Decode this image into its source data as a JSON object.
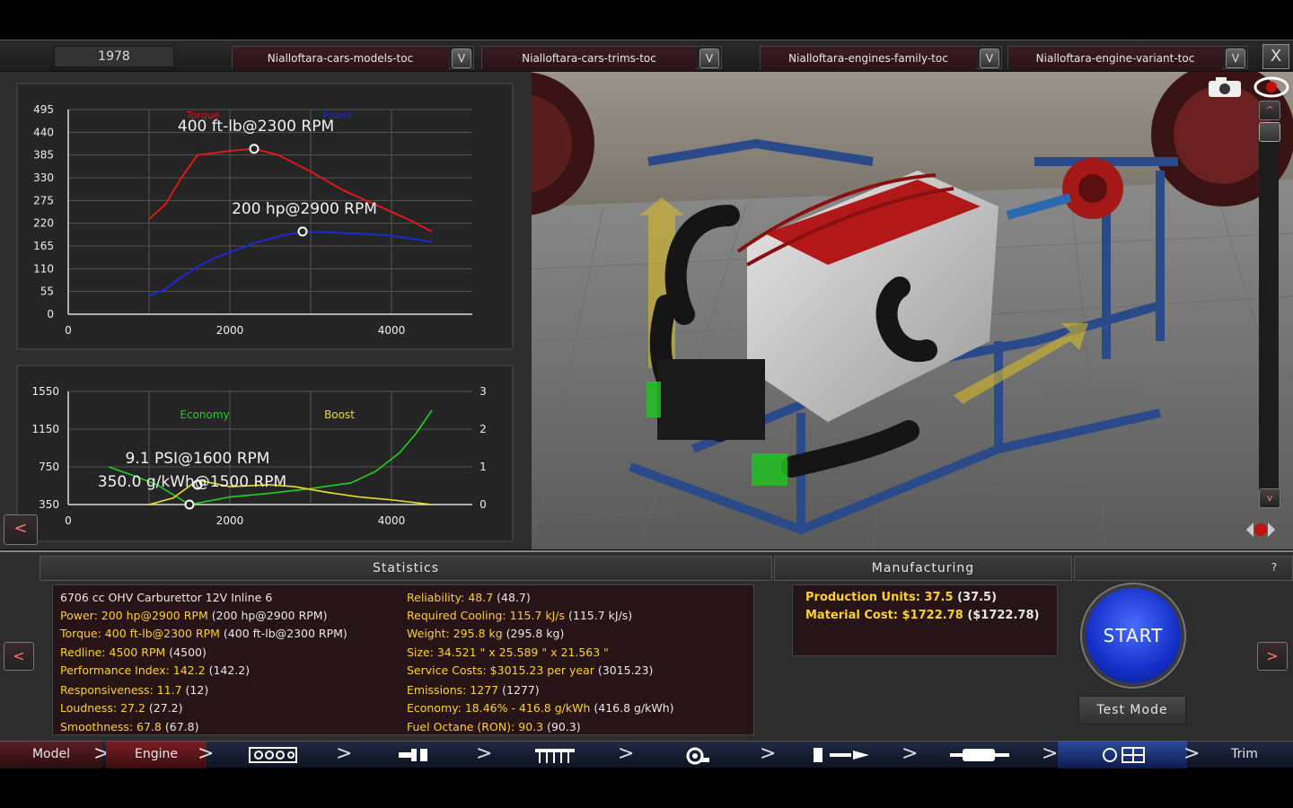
{
  "top": {
    "year": "1978",
    "dropdowns": [
      {
        "label": "Nialloftara-cars-models-toc",
        "arrow": "V"
      },
      {
        "label": "Nialloftara-cars-trims-toc",
        "arrow": "V"
      },
      {
        "label": "Nialloftara-engines-family-toc",
        "arrow": "V"
      },
      {
        "label": "Nialloftara-engine-variant-toc",
        "arrow": "V"
      }
    ],
    "close": "X"
  },
  "left": {
    "collapse": "<"
  },
  "chart_data": [
    {
      "type": "line",
      "x_ticks": [
        "0",
        "2000",
        "4000"
      ],
      "y_ticks": [
        "0",
        "55",
        "110",
        "165",
        "220",
        "275",
        "330",
        "385",
        "440",
        "495"
      ],
      "xlim": [
        0,
        5000
      ],
      "ylim": [
        0,
        495
      ],
      "grid": true,
      "series": [
        {
          "name": "Torque",
          "color": "#e01818",
          "x": [
            1000,
            1200,
            1400,
            1600,
            1800,
            2000,
            2300,
            2600,
            3000,
            3400,
            3800,
            4200,
            4500
          ],
          "y": [
            230,
            265,
            330,
            385,
            390,
            395,
            400,
            385,
            345,
            300,
            265,
            230,
            200
          ]
        },
        {
          "name": "Power",
          "color": "#1a2ad6",
          "x": [
            1000,
            1200,
            1400,
            1600,
            1800,
            2000,
            2300,
            2600,
            2900,
            3200,
            3600,
            4000,
            4500
          ],
          "y": [
            45,
            60,
            90,
            115,
            135,
            150,
            172,
            188,
            200,
            198,
            195,
            190,
            175
          ]
        }
      ],
      "annotations": [
        {
          "text": "400 ft-lb@2300 RPM",
          "x": 2300,
          "y": 400
        },
        {
          "text": "200 hp@2900 RPM",
          "x": 2900,
          "y": 200
        }
      ]
    },
    {
      "type": "line",
      "x_ticks": [
        "0",
        "2000",
        "4000"
      ],
      "y_ticks_left": [
        "350",
        "750",
        "1150",
        "1550"
      ],
      "y_ticks_right": [
        "0",
        "1",
        "2",
        "3"
      ],
      "xlim": [
        0,
        5000
      ],
      "ylim_left": [
        350,
        1550
      ],
      "ylim_right": [
        0,
        3
      ],
      "grid": true,
      "series": [
        {
          "name": "Economy",
          "color": "#22d022",
          "axis": "left",
          "x": [
            500,
            800,
            1100,
            1500,
            2000,
            2500,
            3000,
            3500,
            3800,
            4100,
            4300,
            4500
          ],
          "y": [
            750,
            660,
            560,
            350,
            430,
            470,
            520,
            580,
            700,
            900,
            1100,
            1350
          ]
        },
        {
          "name": "Boost",
          "color": "#e8e020",
          "axis": "left",
          "x": [
            1000,
            1300,
            1600,
            2000,
            2500,
            2800,
            3200,
            3600,
            4000,
            4500
          ],
          "y": [
            350,
            420,
            610,
            540,
            560,
            540,
            480,
            430,
            400,
            350
          ]
        }
      ],
      "annotations": [
        {
          "text": "9.1 PSI@1600 RPM",
          "x": 1600,
          "y": 610
        },
        {
          "text": "350.0 g/kWh@1500 RPM",
          "x": 1500,
          "y": 350
        }
      ]
    }
  ],
  "stats": {
    "title": "Statistics",
    "left": [
      {
        "label": "6706 cc OHV Carburettor 12V Inline 6",
        "value": ""
      },
      {
        "label": "Power: 200 hp@2900 RPM",
        "value": "(200 hp@2900 RPM)"
      },
      {
        "label": "Torque: 400 ft-lb@2300 RPM",
        "value": "(400 ft-lb@2300 RPM)"
      },
      {
        "label": "Redline: 4500 RPM",
        "value": "(4500)"
      },
      {
        "label": "Performance Index: 142.2",
        "value": "(142.2)"
      },
      {
        "label": "Responsiveness: 11.7",
        "value": "(12)"
      },
      {
        "label": "Loudness: 27.2",
        "value": "(27.2)"
      },
      {
        "label": "Smoothness: 67.8",
        "value": "(67.8)"
      }
    ],
    "right": [
      {
        "label": "Reliability: 48.7",
        "value": "(48.7)"
      },
      {
        "label": "Required Cooling: 115.7 kJ/s",
        "value": "(115.7 kJ/s)"
      },
      {
        "label": "Weight: 295.8 kg",
        "value": "(295.8 kg)"
      },
      {
        "label": "Size: 34.521 \" x 25.589 \" x 21.563 \"",
        "value": ""
      },
      {
        "label": "Service Costs: $3015.23 per year",
        "value": "(3015.23)"
      },
      {
        "label": "Emissions: 1277",
        "value": "(1277)"
      },
      {
        "label": "Economy: 18.46% - 416.8 g/kWh",
        "value": "(416.8 g/kWh)"
      },
      {
        "label": "Fuel Octane (RON): 90.3",
        "value": "(90.3)"
      }
    ]
  },
  "manufacturing": {
    "title": "Manufacturing",
    "lines": [
      {
        "label": "Production Units: 37.5",
        "value": "(37.5)"
      },
      {
        "label": "Material Cost: $1722.78",
        "value": "($1722.78)"
      }
    ]
  },
  "controls": {
    "prev": "<",
    "next": ">",
    "help": "?",
    "start": "START",
    "test_mode": "Test Mode"
  },
  "nav": {
    "model": "Model",
    "engine": "Engine",
    "trim": "Trim",
    "chevron": ">",
    "icons": [
      "block-icon",
      "crank-icon",
      "heads-icon",
      "turbo-icon",
      "fuel-icon",
      "exhaust-icon",
      "tune-icon"
    ]
  },
  "view": {
    "scroll_up": "^",
    "scroll_down": "v"
  }
}
